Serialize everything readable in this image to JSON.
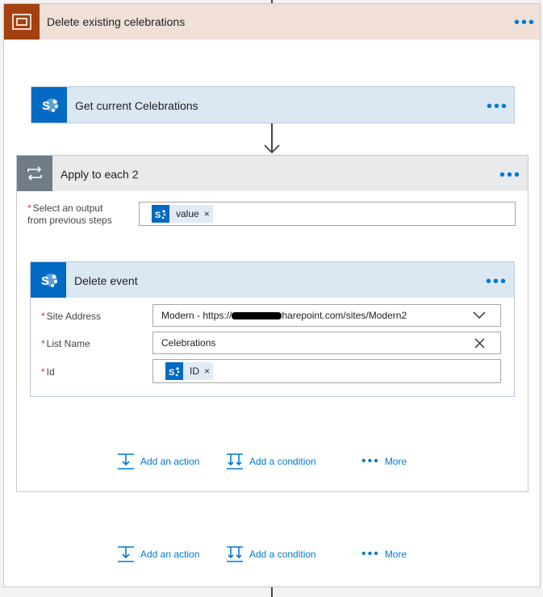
{
  "scope": {
    "title": "Delete existing celebrations",
    "more_label": "•••"
  },
  "get_action": {
    "title": "Get current Celebrations",
    "more_label": "•••"
  },
  "apply_each": {
    "title": "Apply to each 2",
    "more_label": "•••",
    "output_label_line1": "Select an output",
    "output_label_line2": "from previous steps",
    "required_mark": "*",
    "output_token": "value",
    "token_remove": "×"
  },
  "delete_event": {
    "title": "Delete event",
    "more_label": "•••",
    "fields": {
      "site_address": {
        "label": "Site Address",
        "value_prefix": "Modern - https://",
        "value_suffix": "harepoint.com/sites/Modern2"
      },
      "list_name": {
        "label": "List Name",
        "value": "Celebrations"
      },
      "id": {
        "label": "Id",
        "token": "ID"
      }
    }
  },
  "actions_inner": {
    "add_action": "Add an action",
    "add_condition": "Add a condition",
    "more": "More"
  },
  "actions_outer": {
    "add_action": "Add an action",
    "add_condition": "Add a condition",
    "more": "More"
  },
  "icons": {
    "scope": "scope-icon",
    "sharepoint": "sharepoint-icon",
    "loop": "loop-icon",
    "chevron": "chevron-down-icon",
    "clear": "clear-icon",
    "add_action": "add-action-icon",
    "add_condition": "add-condition-icon"
  },
  "colors": {
    "accent": "#0078d4",
    "scope": "#a5410e",
    "sharepoint": "#036ac4",
    "loop": "#707c86",
    "required": "#d13438"
  }
}
